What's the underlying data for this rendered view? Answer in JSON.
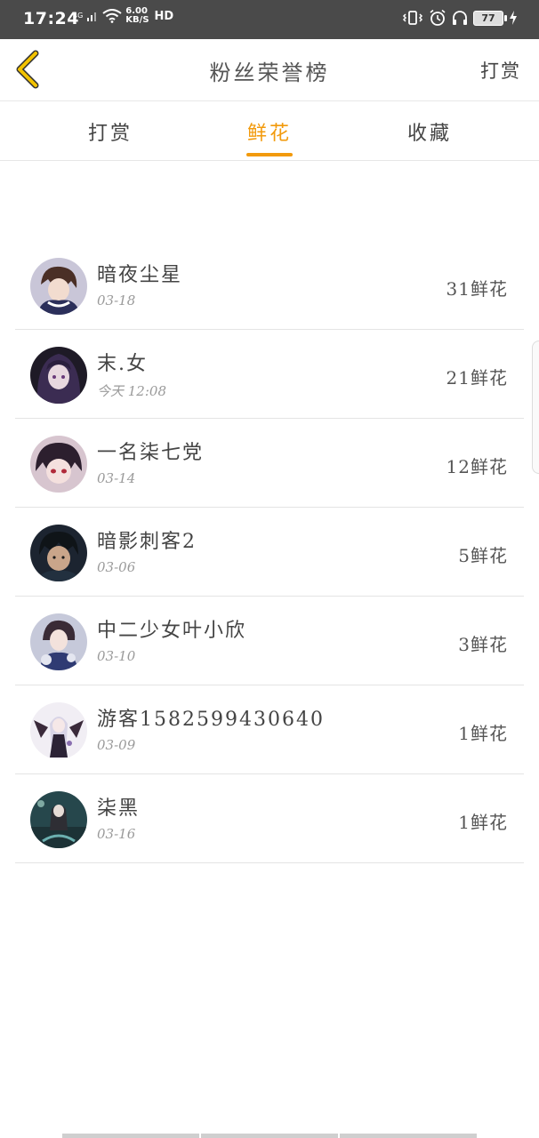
{
  "status_bar": {
    "time": "17:24",
    "network": "4G",
    "speed_value": "6.00",
    "speed_unit": "KB/S",
    "hd": "HD",
    "battery": "77"
  },
  "nav": {
    "title": "粉丝荣誉榜",
    "action_label": "打赏",
    "back_icon": "chevron-left-icon",
    "back_color": "#f2b400"
  },
  "tabs": [
    {
      "label": "打赏",
      "active": false
    },
    {
      "label": "鲜花",
      "active": true
    },
    {
      "label": "收藏",
      "active": false
    }
  ],
  "accent_color": "#f29a0c",
  "ranking": [
    {
      "name": "暗夜尘星",
      "date": "03-18",
      "count": "31鲜花"
    },
    {
      "name": "末.女",
      "date": "今天 12:08",
      "count": "21鲜花"
    },
    {
      "name": "一名柒七党",
      "date": "03-14",
      "count": "12鲜花"
    },
    {
      "name": "暗影刺客2",
      "date": "03-06",
      "count": "5鲜花"
    },
    {
      "name": "中二少女叶小欣",
      "date": "03-10",
      "count": "3鲜花"
    },
    {
      "name": "游客1582599430640",
      "date": "03-09",
      "count": "1鲜花"
    },
    {
      "name": "柒黑",
      "date": "03-16",
      "count": "1鲜花"
    }
  ]
}
